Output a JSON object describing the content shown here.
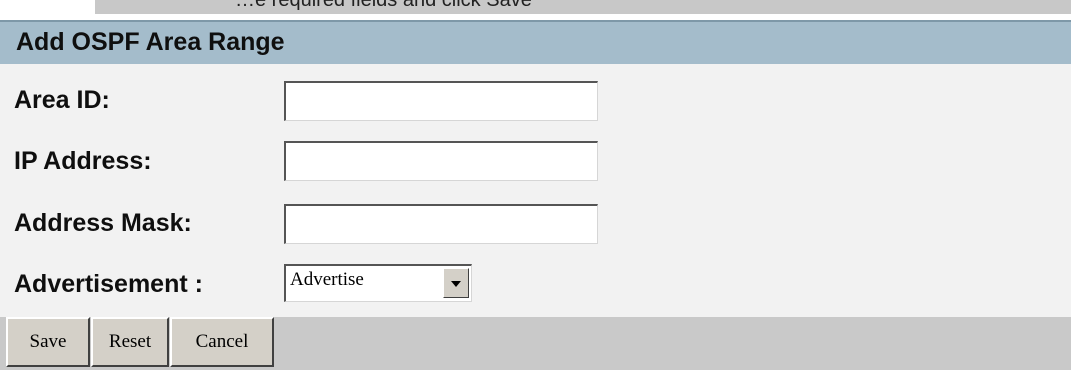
{
  "page": {
    "top_partial_text": "…e required fields and click Save"
  },
  "form": {
    "title": "Add OSPF Area Range",
    "fields": [
      {
        "label": "Area ID:",
        "value": "",
        "placeholder": ""
      },
      {
        "label": "IP Address:",
        "value": "",
        "placeholder": ""
      },
      {
        "label": "Address Mask:",
        "value": "",
        "placeholder": ""
      }
    ],
    "advertisement": {
      "label": "Advertisement :",
      "selected": "Advertise"
    }
  },
  "buttons": {
    "save": "Save",
    "reset": "Reset",
    "cancel": "Cancel"
  },
  "colors": {
    "title_bar": "#a4bccb",
    "panel_bg": "#f2f2f2",
    "button_bar": "#c9c9c9",
    "button_face": "#d4d0c8"
  },
  "icons": {
    "dropdown": "chevron-down-icon"
  }
}
